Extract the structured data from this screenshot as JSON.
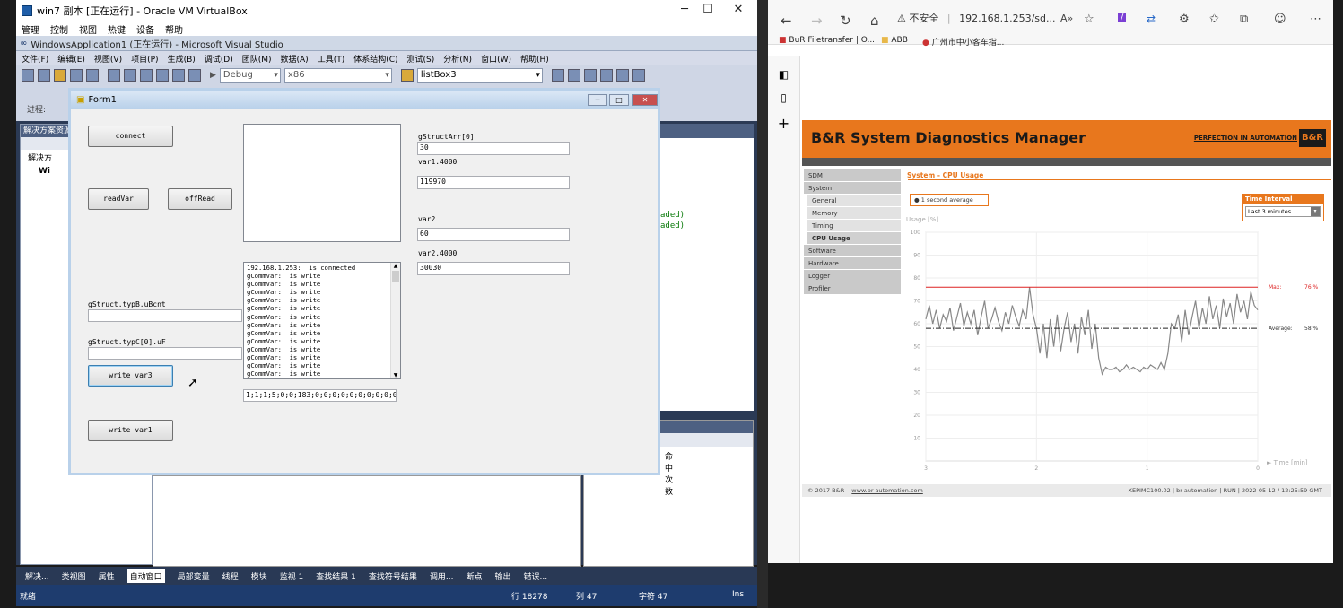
{
  "vbox": {
    "title": "win7 副本 [正在运行] - Oracle VM VirtualBox",
    "menu": [
      "管理",
      "控制",
      "视图",
      "热键",
      "设备",
      "帮助"
    ]
  },
  "vs": {
    "title": "WindowsApplication1 (正在运行) - Microsoft Visual Studio",
    "menu": [
      "文件(F)",
      "编辑(E)",
      "视图(V)",
      "项目(P)",
      "生成(B)",
      "调试(D)",
      "团队(M)",
      "数据(A)",
      "工具(T)",
      "体系结构(C)",
      "测试(S)",
      "分析(N)",
      "窗口(W)",
      "帮助(H)"
    ],
    "config": "Debug",
    "platform": "x86",
    "target": "listBox3",
    "progress_label": "进程:",
    "solution_panel": "解决方案资源",
    "tree": [
      "解决方",
      "Wi"
    ],
    "editor_lines": [
      "aded)",
      "aded)"
    ],
    "right_col_header": "命中次数",
    "tabs": [
      "解决...",
      "类视图",
      "属性",
      "自动窗口",
      "局部变量",
      "线程",
      "模块",
      "监视 1",
      "查找结果 1",
      "查找符号结果",
      "调用...",
      "断点",
      "输出",
      "错误..."
    ],
    "status": {
      "ready": "就绪",
      "line": "行 18278",
      "col": "列 47",
      "char": "字符 47",
      "mode": "Ins"
    }
  },
  "form1": {
    "title": "Form1",
    "connect": "connect",
    "readVar": "readVar",
    "offRead": "offRead",
    "write_var3": "write var3",
    "write_var1": "write var1",
    "lbl_typB": "gStruct.typB.uBcnt",
    "lbl_typC": "gStruct.typC[0].uF",
    "lbl_arr": "gStructArr[0]",
    "val_arr": "30",
    "lbl_var1": "var1.4000",
    "val_var1": "119970",
    "lbl_var2": "var2",
    "val_var2": "60",
    "lbl_var2b": "var2.4000",
    "val_var2b": "30030",
    "log": [
      "192.168.1.253:  is connected",
      "gCommVar:  is write",
      "gCommVar:  is write",
      "gCommVar:  is write",
      "gCommVar:  is write",
      "gCommVar:  is write",
      "gCommVar:  is write",
      "gCommVar:  is write",
      "gCommVar:  is write",
      "gCommVar:  is write",
      "gCommVar:  is write",
      "gCommVar:  is write",
      "gCommVar:  is write",
      "gCommVar:  is write"
    ],
    "bottom_text": "1;1;1;5;0;0;183;0;0;0;0;0;0;0;0;0;0;0;0"
  },
  "browser": {
    "insecure": "不安全",
    "url": "192.168.1.253/sd...",
    "fav": [
      "BuR Filetransfer | O...",
      "ABB",
      "广州市中小客车指..."
    ]
  },
  "sdm": {
    "title": "B&R System Diagnostics Manager",
    "slogan": "PERFECTION IN AUTOMATION",
    "logo": "B&R",
    "nav": [
      {
        "label": "SDM",
        "sub": false
      },
      {
        "label": "System",
        "sub": false
      },
      {
        "label": "General",
        "sub": true
      },
      {
        "label": "Memory",
        "sub": true
      },
      {
        "label": "Timing",
        "sub": true
      },
      {
        "label": "CPU Usage",
        "sub": true
      },
      {
        "label": "Software",
        "sub": false
      },
      {
        "label": "Hardware",
        "sub": false
      },
      {
        "label": "Logger",
        "sub": false
      },
      {
        "label": "Profiler",
        "sub": false
      }
    ],
    "section": "System - CPU Usage",
    "legend": "1 second average",
    "interval_title": "Time Interval",
    "interval_value": "Last 3 minutes",
    "footer_left": "© 2017 B&R",
    "footer_link": "www.br-automation.com",
    "footer_right": "XEPIMC100.02 | br-automation | RUN | 2022-05-12 / 12:25:59 GMT"
  },
  "chart_data": {
    "type": "line",
    "ylabel": "Usage [%]",
    "xlabel": "Time [min]",
    "ylim": [
      0,
      100
    ],
    "xlim": [
      3,
      0
    ],
    "yticks": [
      "100",
      "90",
      "80",
      "70",
      "60",
      "50",
      "40",
      "30",
      "20",
      "10"
    ],
    "xticks": [
      "3",
      "2",
      "1",
      "0"
    ],
    "max_label": "Max:",
    "max_value": "76 %",
    "max": 76,
    "avg_label": "Average:",
    "avg_value": "58 %",
    "avg": 58,
    "series": [
      {
        "values": [
          62,
          68,
          60,
          66,
          58,
          64,
          61,
          67,
          57,
          63,
          69,
          59,
          65,
          60,
          66,
          55,
          63,
          70,
          58,
          62,
          67,
          61,
          57,
          65,
          60,
          68,
          63,
          59,
          66,
          62,
          76,
          64,
          58,
          47,
          60,
          45,
          62,
          50,
          64,
          48,
          58,
          65,
          52,
          60,
          47,
          63,
          55,
          66,
          49,
          60,
          45,
          38,
          41,
          40,
          40,
          41,
          39,
          40,
          42,
          40,
          41,
          40,
          39,
          41,
          40,
          42,
          41,
          40,
          43,
          40,
          47,
          60,
          58,
          64,
          52,
          66,
          55,
          63,
          70,
          58,
          67,
          60,
          72,
          62,
          68,
          58,
          71,
          63,
          69,
          60,
          73,
          65,
          70,
          62,
          74,
          68,
          66
        ]
      }
    ]
  }
}
